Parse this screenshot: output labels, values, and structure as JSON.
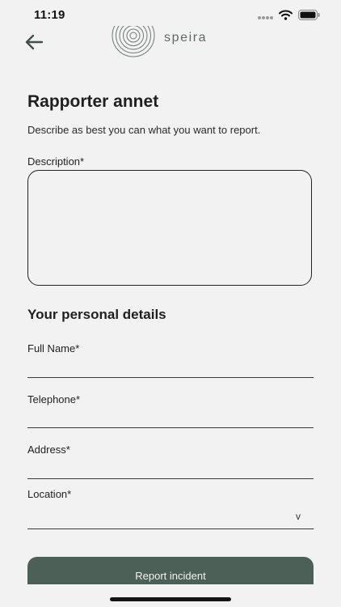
{
  "status_bar": {
    "time": "11:19",
    "icons": [
      "signal-dots-icon",
      "wifi-icon",
      "battery-icon"
    ]
  },
  "header": {
    "back_icon": "arrow-left-icon",
    "logo_text": "speira"
  },
  "page": {
    "title": "Rapporter annet",
    "subtitle": "Describe as best you can what you want to report."
  },
  "description": {
    "label": "Description*",
    "value": ""
  },
  "personal_details": {
    "title": "Your personal details",
    "full_name_label": "Full Name*",
    "full_name_value": "",
    "telephone_label": "Telephone*",
    "telephone_value": "",
    "address_label": "Address*",
    "address_value": "",
    "location_label": "Location*",
    "location_value": "",
    "location_chevron": "v"
  },
  "actions": {
    "report_label": "Report incident"
  },
  "colors": {
    "background": "#f2f2f2",
    "brand": "#4c6058",
    "logo": "#5b6b67",
    "text": "#1f1f1f"
  }
}
